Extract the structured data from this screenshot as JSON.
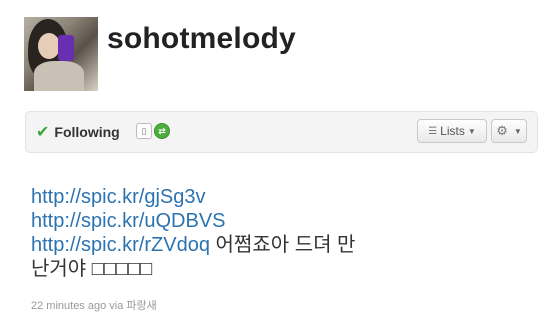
{
  "profile": {
    "screen_name": "sohotmelody"
  },
  "actions": {
    "following_label": "Following",
    "lists_label": "Lists"
  },
  "tweet": {
    "links": [
      "http://spic.kr/gjSg3v",
      "http://spic.kr/uQDBVS",
      "http://spic.kr/rZVdoq"
    ],
    "text_line3": "어쩜죠아 드뎌 만",
    "text_line4": "난거야 □□□□□",
    "time": "22 minutes ago",
    "via_prefix": "via",
    "source": "파랑새"
  },
  "colors": {
    "link": "#2b73b1",
    "check": "#3ea53e",
    "retweet_badge": "#4cae3c"
  },
  "icons": [
    "check-icon",
    "device-icon",
    "retweet-icon",
    "list-icon",
    "gear-icon",
    "chevron-down-icon"
  ]
}
